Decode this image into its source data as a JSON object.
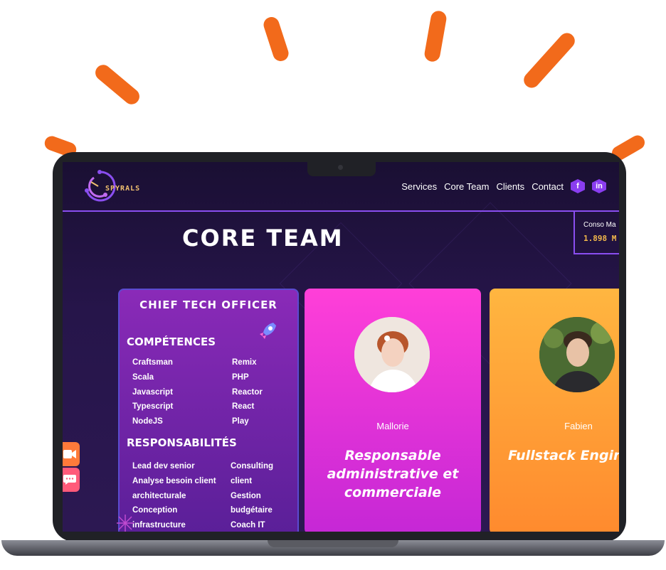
{
  "header": {
    "logo_text": "SPYRALS",
    "nav": [
      "Services",
      "Core Team",
      "Clients",
      "Contact"
    ],
    "social": {
      "facebook": "f",
      "linkedin": "in"
    }
  },
  "page_title": "CORE TEAM",
  "conso": {
    "label": "Conso Ma",
    "value": "1.898 M"
  },
  "cards": [
    {
      "title": "CHIEF TECH OFFICER",
      "competences_title": "COMPÉTENCES",
      "competences_col1": [
        "Craftsman",
        "Scala",
        "Javascript",
        "Typescript",
        "NodeJS"
      ],
      "competences_col2": [
        "Remix",
        "PHP",
        "Reactor",
        "React",
        "Play"
      ],
      "responsabilites_title": "RESPONSABILITÉS",
      "resp_col1": [
        "Lead dev senior",
        "Analyse besoin client",
        "architecturale",
        "Conception",
        "infrastructure"
      ],
      "resp_col2": [
        "Consulting",
        "client",
        "Gestion",
        "budgétaire",
        "Coach IT"
      ]
    },
    {
      "name": "Mallorie",
      "role": [
        "Responsable",
        "administrative et",
        "commerciale"
      ]
    },
    {
      "name": "Fabien",
      "role": [
        "Fullstack Engir"
      ]
    }
  ],
  "colors": {
    "accent": "#8a4ef0",
    "orange": "#f26a1b",
    "gold": "#f2b84b",
    "pink": "#ff3fd8"
  },
  "side_buttons": [
    "video-icon",
    "chat-icon"
  ]
}
